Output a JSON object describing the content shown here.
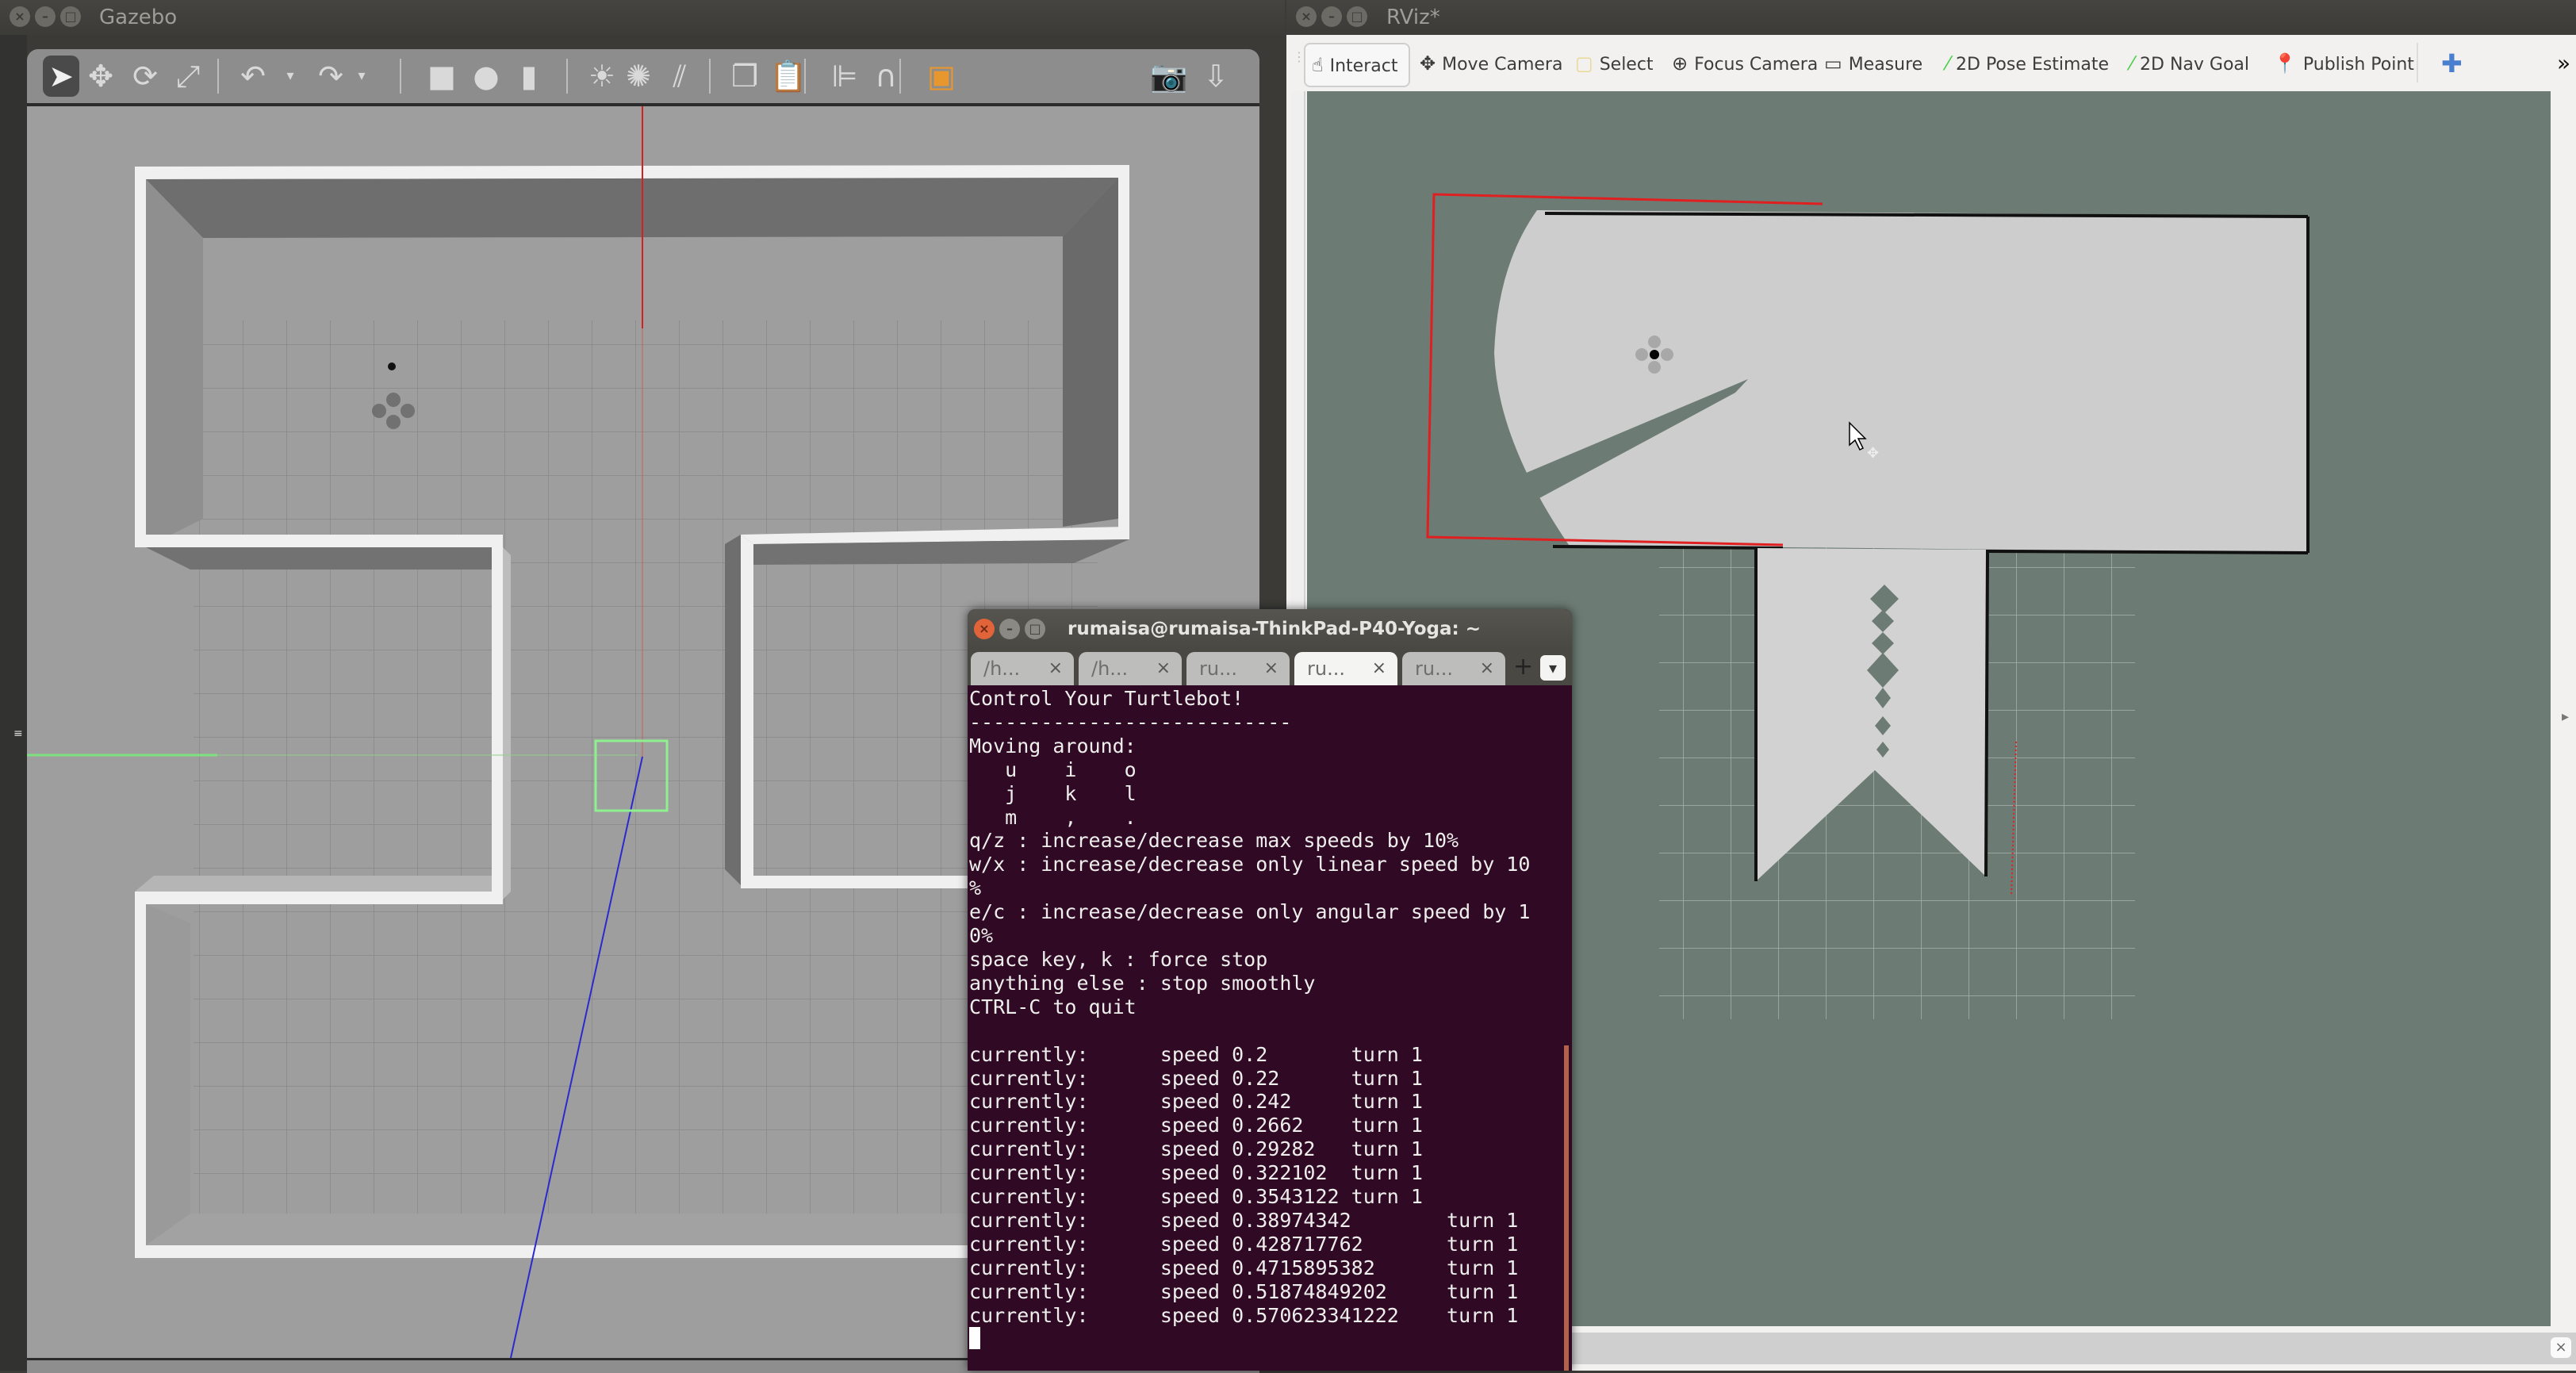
{
  "gazebo": {
    "title": "Gazebo",
    "toolbar": [
      {
        "name": "select-mode-icon",
        "glyph": "➤",
        "active": true
      },
      {
        "name": "translate-mode-icon",
        "glyph": "✥"
      },
      {
        "name": "rotate-mode-icon",
        "glyph": "⟳"
      },
      {
        "name": "scale-mode-icon",
        "glyph": "⤢"
      },
      {
        "name": "undo-icon",
        "glyph": "↶"
      },
      {
        "name": "undo-history-icon",
        "glyph": "▾"
      },
      {
        "name": "redo-icon",
        "glyph": "↷"
      },
      {
        "name": "redo-history-icon",
        "glyph": "▾"
      },
      {
        "name": "box-shape-icon",
        "glyph": "■"
      },
      {
        "name": "sphere-shape-icon",
        "glyph": "●"
      },
      {
        "name": "cylinder-shape-icon",
        "glyph": "▮"
      },
      {
        "name": "point-light-icon",
        "glyph": "☀"
      },
      {
        "name": "spot-light-icon",
        "glyph": "✺"
      },
      {
        "name": "directional-light-icon",
        "glyph": "⫽"
      },
      {
        "name": "copy-icon",
        "glyph": "❐"
      },
      {
        "name": "paste-icon",
        "glyph": "📋"
      },
      {
        "name": "align-icon",
        "glyph": "⊫"
      },
      {
        "name": "snap-icon",
        "glyph": "∩"
      },
      {
        "name": "view-angle-icon",
        "glyph": "▣"
      },
      {
        "name": "screenshot-icon",
        "glyph": "📷"
      },
      {
        "name": "log-icon",
        "glyph": "⇩"
      }
    ]
  },
  "rviz": {
    "title": "RViz*",
    "toolbar": [
      {
        "name": "interact",
        "label": "Interact",
        "icon": "hand-pointer-icon",
        "glyph": "☝",
        "active": true
      },
      {
        "name": "move-camera",
        "label": "Move Camera",
        "icon": "move-camera-icon",
        "glyph": "✥"
      },
      {
        "name": "select",
        "label": "Select",
        "icon": "select-icon",
        "glyph": "▢"
      },
      {
        "name": "focus-camera",
        "label": "Focus Camera",
        "icon": "focus-camera-icon",
        "glyph": "⊕"
      },
      {
        "name": "measure",
        "label": "Measure",
        "icon": "ruler-icon",
        "glyph": "▭"
      },
      {
        "name": "2d-pose-estimate",
        "label": "2D Pose Estimate",
        "icon": "pose-arrow-icon",
        "glyph": "⁄"
      },
      {
        "name": "2d-nav-goal",
        "label": "2D Nav Goal",
        "icon": "nav-arrow-icon",
        "glyph": "⁄"
      },
      {
        "name": "publish-point",
        "label": "Publish Point",
        "icon": "map-pin-icon",
        "glyph": "📍"
      }
    ],
    "add_tool_glyph": "✚",
    "overflow_glyph": "»"
  },
  "terminal": {
    "title": "rumaisa@rumaisa-ThinkPad-P40-Yoga: ~",
    "tabs": [
      {
        "label": "/h...",
        "active": false
      },
      {
        "label": "/h...",
        "active": false
      },
      {
        "label": "ru...",
        "active": false
      },
      {
        "label": "ru...",
        "active": true
      },
      {
        "label": "ru...",
        "active": false
      }
    ],
    "new_tab": "+",
    "menu_glyph": "▾",
    "header_lines": [
      "Control Your Turtlebot!",
      "---------------------------",
      "Moving around:",
      "   u    i    o",
      "   j    k    l",
      "   m    ,    .",
      "q/z : increase/decrease max speeds by 10%",
      "w/x : increase/decrease only linear speed by 10",
      "%",
      "e/c : increase/decrease only angular speed by 1",
      "0%",
      "space key, k : force stop",
      "anything else : stop smoothly",
      "CTRL-C to quit",
      ""
    ],
    "speed_lines": [
      {
        "prefix": "currently:",
        "speed": "0.2",
        "turn": "1"
      },
      {
        "prefix": "currently:",
        "speed": "0.22",
        "turn": "1"
      },
      {
        "prefix": "currently:",
        "speed": "0.242",
        "turn": "1"
      },
      {
        "prefix": "currently:",
        "speed": "0.2662",
        "turn": "1"
      },
      {
        "prefix": "currently:",
        "speed": "0.29282",
        "turn": "1"
      },
      {
        "prefix": "currently:",
        "speed": "0.322102",
        "turn": "1"
      },
      {
        "prefix": "currently:",
        "speed": "0.3543122",
        "turn": "1"
      },
      {
        "prefix": "currently:",
        "speed": "0.38974342",
        "turn": "1"
      },
      {
        "prefix": "currently:",
        "speed": "0.428717762",
        "turn": "1"
      },
      {
        "prefix": "currently:",
        "speed": "0.4715895382",
        "turn": "1"
      },
      {
        "prefix": "currently:",
        "speed": "0.51874849202",
        "turn": "1"
      },
      {
        "prefix": "currently:",
        "speed": "0.570623341222",
        "turn": "1"
      }
    ]
  },
  "colors": {
    "terminal_bg": "#300a24",
    "rviz_bg": "#6c7b74",
    "gazebo_floor": "#9e9e9e",
    "close_button": "#e0633a",
    "laser_red": "#e02020",
    "selection_green": "#7cf07c"
  }
}
